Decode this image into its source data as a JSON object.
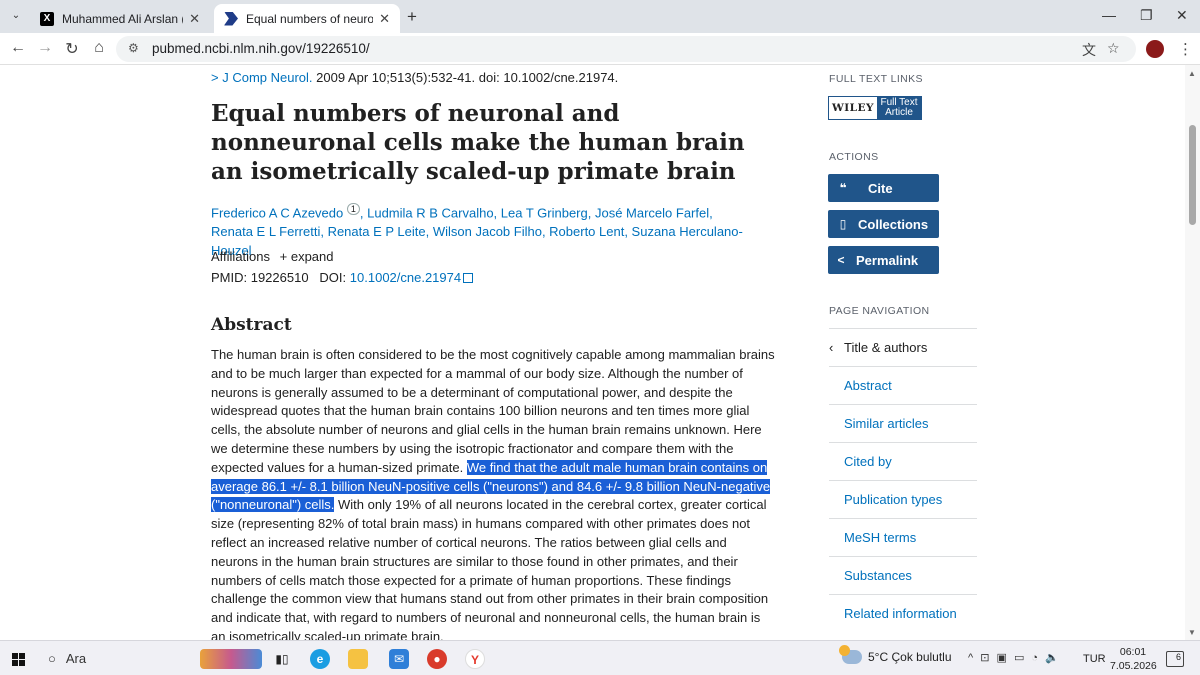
{
  "browser": {
    "tabs": [
      {
        "title": "Muhammed Ali Arslan (@Miracl",
        "active": false
      },
      {
        "title": "Equal numbers of neuronal and",
        "active": true
      }
    ],
    "url": "pubmed.ncbi.nlm.nih.gov/19226510/"
  },
  "article": {
    "journal_link": "J Comp Neurol.",
    "citation": " 2009 Apr 10;513(5):532-41. doi: 10.1002/cne.21974.",
    "title": "Equal numbers of neuronal and nonneuronal cells make the human brain an isometrically scaled-up primate brain",
    "authors_first": "Frederico A C Azevedo",
    "author_sup": "1",
    "authors_rest": ", Ludmila R B Carvalho, Lea T Grinberg, José Marcelo Farfel,",
    "authors_line2": "Renata E L Ferretti, Renata E P Leite, Wilson Jacob Filho, Roberto Lent, Suzana Herculano-Houzel",
    "affiliations_label": "Affiliations",
    "expand_label": "+ expand",
    "pmid_label": "PMID: 19226510",
    "doi_label": "DOI:",
    "doi_value": "10.1002/cne.21974",
    "abstract_heading": "Abstract",
    "abstract_before": "The human brain is often considered to be the most cognitively capable among mammalian brains and to be much larger than expected for a mammal of our body size. Although the number of neurons is generally assumed to be a determinant of computational power, and despite the widespread quotes that the human brain contains 100 billion neurons and ten times more glial cells, the absolute number of neurons and glial cells in the human brain remains unknown. Here we determine these numbers by using the isotropic fractionator and compare them with the expected values for a human-sized primate. ",
    "abstract_highlight": "We find that the adult male human brain contains on average 86.1 +/- 8.1 billion NeuN-positive cells (\"neurons\") and 84.6 +/- 9.8 billion NeuN-negative (\"nonneuronal\") cells.",
    "abstract_after": " With only 19% of all neurons located in the cerebral cortex, greater cortical size (representing 82% of total brain mass) in humans compared with other primates does not reflect an increased relative number of cortical neurons. The ratios between glial cells and neurons in the human brain structures are similar to those found in other primates, and their numbers of cells match those expected for a primate of human proportions. These findings challenge the common view that humans stand out from other primates in their brain composition and indicate that, with regard to numbers of neuronal and nonneuronal cells, the human brain is an isometrically scaled-up primate brain."
  },
  "sidebar": {
    "full_text_heading": "FULL TEXT LINKS",
    "wiley_label": "WILEY",
    "full_text_line1": "Full Text",
    "full_text_line2": "Article",
    "actions_heading": "ACTIONS",
    "actions": [
      {
        "label": "Cite",
        "icon": "quote-icon"
      },
      {
        "label": "Collections",
        "icon": "bookmark-icon"
      },
      {
        "label": "Permalink",
        "icon": "share-icon"
      }
    ],
    "page_nav_heading": "PAGE NAVIGATION",
    "page_nav": [
      "Title & authors",
      "Abstract",
      "Similar articles",
      "Cited by",
      "Publication types",
      "MeSH terms",
      "Substances",
      "Related information"
    ]
  },
  "taskbar": {
    "search_label": "Ara",
    "weather": "5°C  Çok bulutlu",
    "language": "TUR",
    "time": "06:01",
    "date": "7.05.2026",
    "notifications": "6"
  },
  "colors": {
    "link": "#0071bc",
    "action": "#20558a",
    "highlight": "#1a5fd6"
  }
}
